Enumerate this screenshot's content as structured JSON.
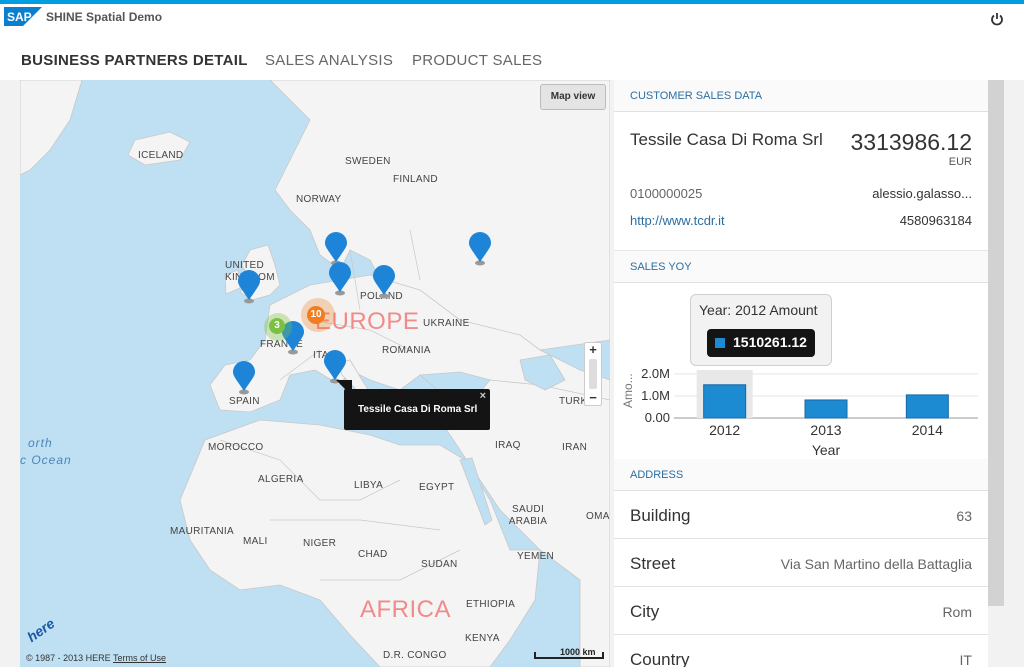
{
  "app": {
    "title": "SHINE Spatial Demo",
    "logo_text": "SAP"
  },
  "tabs": [
    {
      "label": "BUSINESS PARTNERS DETAIL",
      "active": true
    },
    {
      "label": "SALES ANALYSIS",
      "active": false
    },
    {
      "label": "PRODUCT SALES",
      "active": false
    }
  ],
  "map": {
    "map_view_button": "Map view",
    "labels": {
      "iceland": "ICELAND",
      "sweden": "SWEDEN",
      "finland": "FINLAND",
      "norway": "NORWAY",
      "uk": "UNITED KINGDOM",
      "poland": "POLAND",
      "ukraine": "UKRAINE",
      "france": "FRANCE",
      "romania": "ROMANIA",
      "italy": "ITA",
      "spain": "SPAIN",
      "europe": "EUROPE",
      "turkey": "TURK",
      "morocco": "MOROCCO",
      "algeria": "ALGERIA",
      "libya": "LIBYA",
      "egypt": "EGYPT",
      "iraq": "IRAQ",
      "iran": "IRAN",
      "saudi": "SAUDI ARABIA",
      "oman": "OMAN",
      "mauritania": "MAURITANIA",
      "mali": "MALI",
      "niger": "NIGER",
      "chad": "CHAD",
      "sudan": "SUDAN",
      "yemen": "YEMEN",
      "ethiopia": "ETHIOPIA",
      "kenya": "KENYA",
      "congo": "D.R. CONGO",
      "africa": "AFRICA",
      "ocean_1": "orth",
      "ocean_2": "c Ocean"
    },
    "clusters": [
      {
        "count": "10",
        "color": "#f07d1e"
      },
      {
        "count": "3",
        "color": "#7ac143"
      }
    ],
    "tooltip": "Tessile Casa Di Roma Srl",
    "tooltip_close": "×",
    "zoom_in": "+",
    "zoom_out": "−",
    "logo": "here",
    "copyright": "© 1987 - 2013 HERE",
    "terms": "Terms of Use",
    "scale": "1000 km"
  },
  "customer": {
    "section_title": "CUSTOMER SALES DATA",
    "name": "Tessile Casa Di Roma Srl",
    "amount": "3313986.12",
    "currency": "EUR",
    "id": "0100000025",
    "email": "alessio.galasso...",
    "website": "http://www.tcdr.it",
    "phone": "4580963184"
  },
  "sales_yoy": {
    "section_title": "SALES YOY",
    "tooltip_title": "Year: 2012  Amount",
    "tooltip_value": "1510261.12"
  },
  "chart_data": {
    "type": "bar",
    "categories": [
      "2012",
      "2013",
      "2014"
    ],
    "values": [
      1510261.12,
      820000,
      1050000
    ],
    "xlabel": "Year",
    "ylabel": "Amo...",
    "yticks": [
      "0.00",
      "1.0M",
      "2.0M"
    ],
    "ylim": [
      0,
      2000000
    ],
    "bar_color": "#1d8bd1",
    "highlight_index": 0
  },
  "address": {
    "section_title": "ADDRESS",
    "rows": [
      {
        "label": "Building",
        "value": "63"
      },
      {
        "label": "Street",
        "value": "Via San Martino della Battaglia"
      },
      {
        "label": "City",
        "value": "Rom"
      },
      {
        "label": "Country",
        "value": "IT"
      }
    ]
  },
  "colors": {
    "accent": "#009de0",
    "link": "#2b6ea1",
    "pin": "#1d84d8"
  }
}
